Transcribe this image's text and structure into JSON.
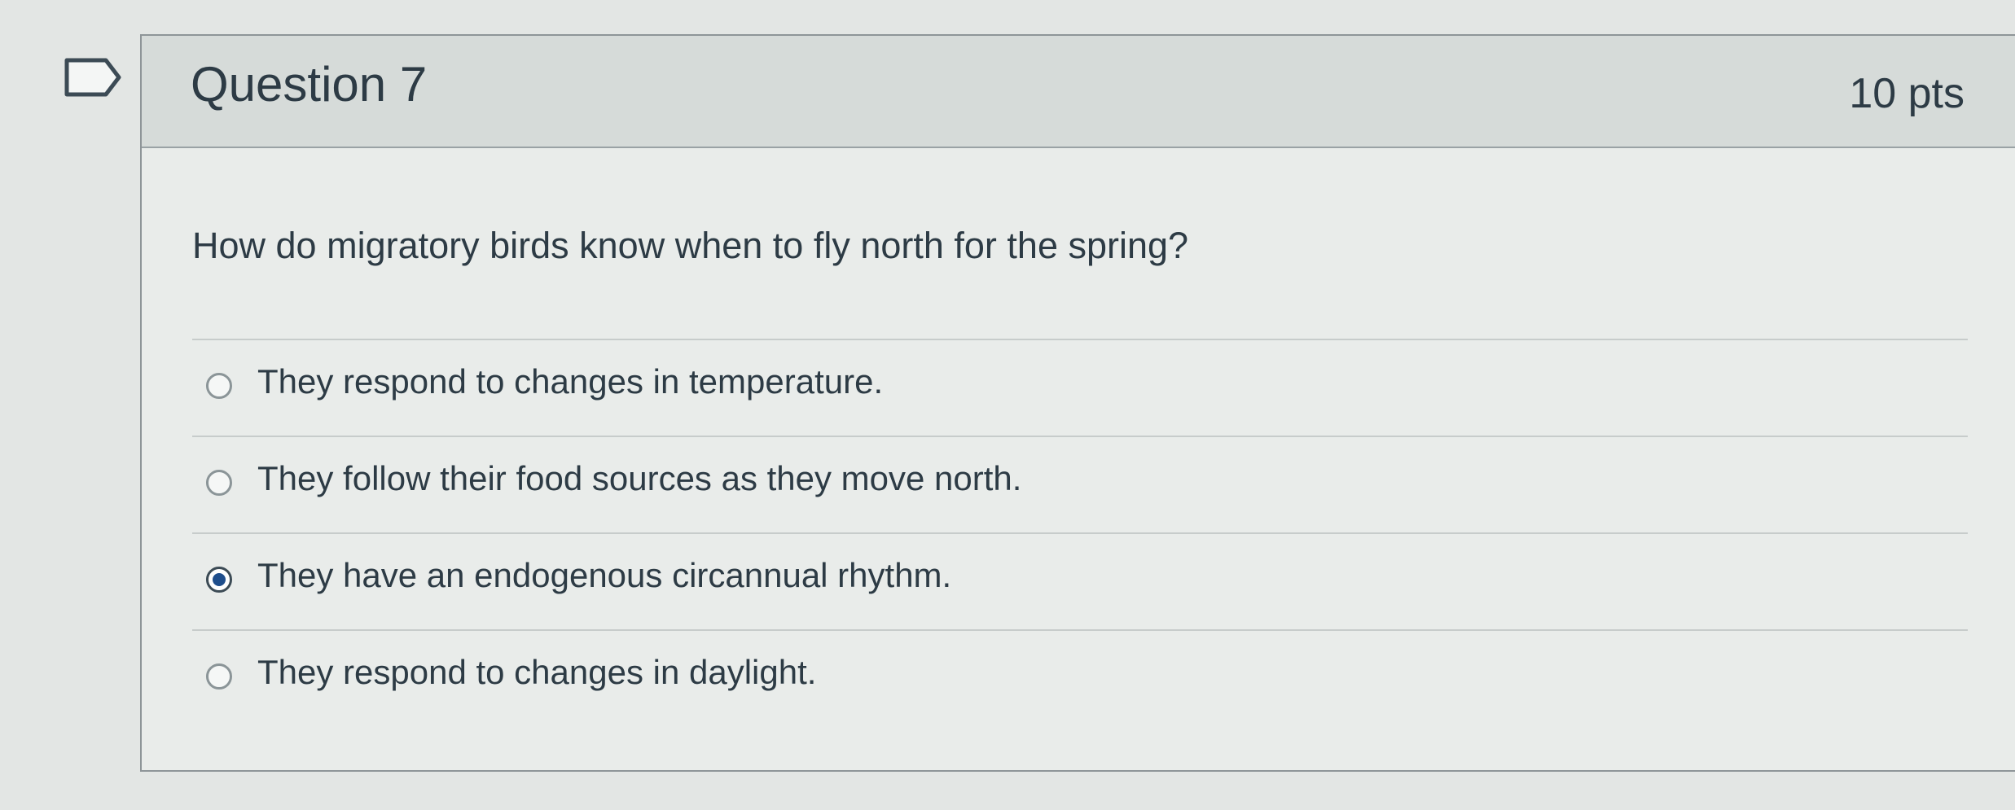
{
  "question": {
    "title": "Question 7",
    "points": "10 pts",
    "text": "How do migratory birds know when to fly north for the spring?",
    "flag_icon": "flag-icon",
    "answers": [
      {
        "label": "They respond to changes in temperature.",
        "selected": false
      },
      {
        "label": "They follow their food sources as they move north.",
        "selected": false
      },
      {
        "label": "They have an endogenous circannual rhythm.",
        "selected": true
      },
      {
        "label": "They respond to changes in daylight.",
        "selected": false
      }
    ]
  },
  "colors": {
    "selected_radio": "#1f4e8c",
    "text": "#2d3b45",
    "header_bg": "#d6dbd9"
  }
}
